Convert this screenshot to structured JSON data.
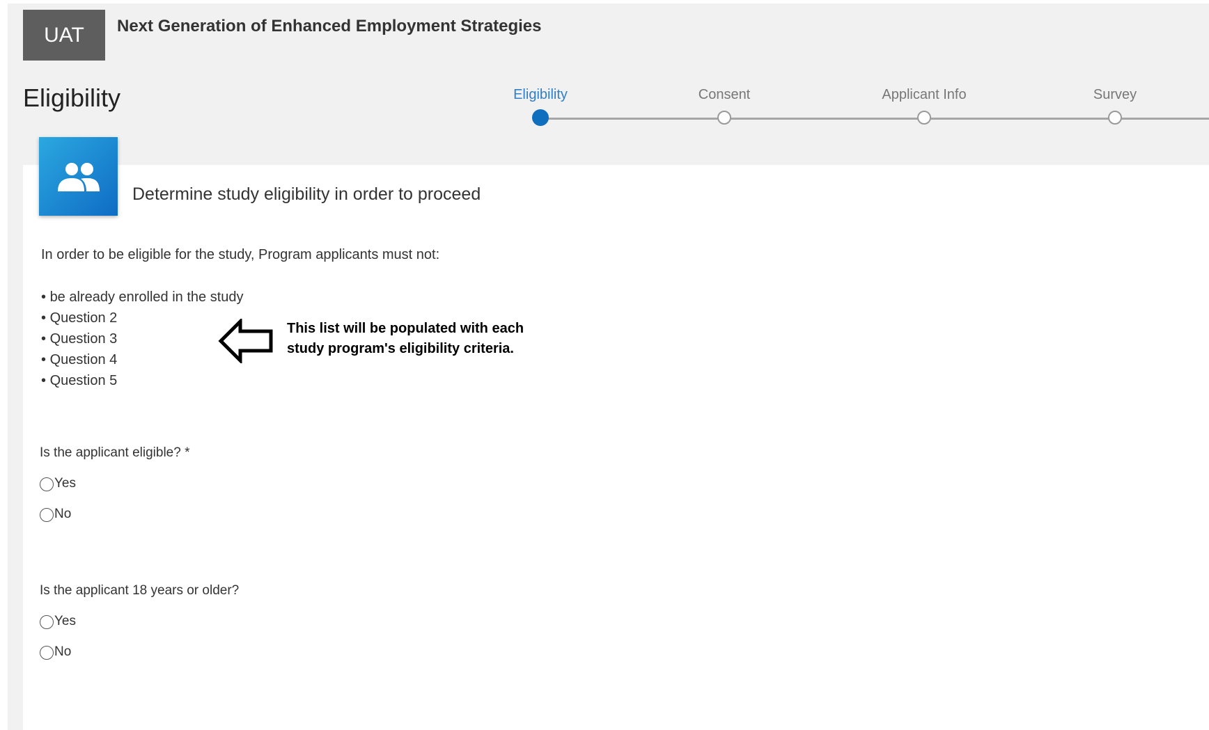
{
  "header": {
    "env_badge": "UAT",
    "app_title": "Next Generation of Enhanced Employment Strategies",
    "page_title": "Eligibility"
  },
  "stepper": {
    "steps": [
      {
        "label": "Eligibility",
        "active": true
      },
      {
        "label": "Consent",
        "active": false
      },
      {
        "label": "Applicant Info",
        "active": false
      },
      {
        "label": "Survey",
        "active": false
      }
    ]
  },
  "card": {
    "icon": "people-icon",
    "heading": "Determine study eligibility in order to proceed",
    "intro": "In order to be eligible for the study, Program applicants must not:",
    "criteria": [
      "be already enrolled in the study",
      "Question 2",
      "Question 3",
      "Question 4",
      "Question 5"
    ],
    "annotation": {
      "icon": "left-arrow-icon",
      "line1": "This list will be populated with each",
      "line2": "study program's eligibility criteria."
    },
    "questions": [
      {
        "label": "Is the applicant eligible? *",
        "options": [
          "Yes",
          "No"
        ]
      },
      {
        "label": "Is the applicant 18 years or older?",
        "options": [
          "Yes",
          "No"
        ]
      }
    ]
  },
  "colors": {
    "accent": "#106ebe",
    "active_step_label": "#2f7fc8",
    "badge_bg": "#5e5e5e",
    "app_bg": "#f1f1f1"
  }
}
